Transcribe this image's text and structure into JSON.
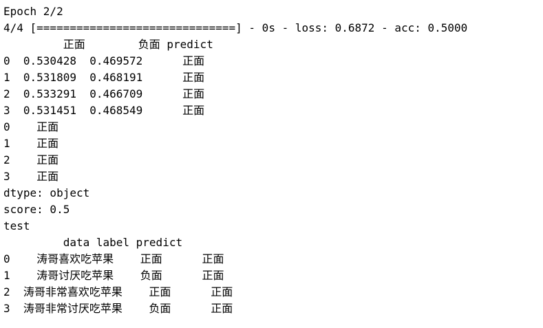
{
  "console": {
    "lines": [
      "Epoch 2/2",
      "4/4 [==============================] - 0s - loss: 0.6872 - acc: 0.5000",
      "         正面        负面 predict",
      "0  0.530428  0.469572      正面",
      "1  0.531809  0.468191      正面",
      "2  0.533291  0.466709      正面",
      "3  0.531451  0.468549      正面",
      "0    正面",
      "1    正面",
      "2    正面",
      "3    正面",
      "dtype: object",
      "score: 0.5",
      "test",
      "         data label predict",
      "0    涛哥喜欢吃苹果    正面      正面",
      "1    涛哥讨厌吃苹果    负面      正面",
      "2  涛哥非常喜欢吃苹果    正面      正面",
      "3  涛哥非常讨厌吃苹果    负面      正面"
    ]
  }
}
